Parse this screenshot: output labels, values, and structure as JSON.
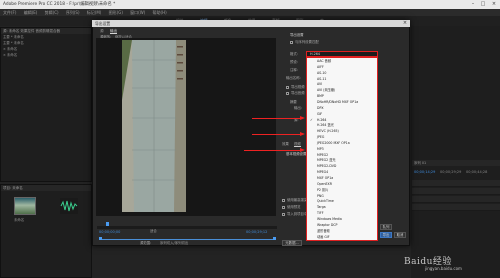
{
  "app": {
    "title": "Adobe Premiere Pro CC 2018 - F:\\pr\\编辑视频\\未命名 *",
    "menu": [
      "文件(F)",
      "编辑(E)",
      "剪辑(C)",
      "序列(S)",
      "标记(M)",
      "图形(G)",
      "窗口(W)",
      "帮助(H)"
    ],
    "workspaces": [
      "组件",
      "编辑",
      "颜色",
      "效果",
      "音频",
      "图形",
      "库"
    ],
    "active_workspace": "编辑"
  },
  "left_panel": {
    "header": "源: 未命名   效果控件   音频剪辑混合器",
    "rows": [
      "主要 * 未命名",
      "主要 * 未命名",
      "× 未命名",
      "× 未命名"
    ]
  },
  "project_panel": {
    "header": "项目: 未命名",
    "clip_label": "未命名"
  },
  "dialog": {
    "title": "导出设置",
    "close_glyph": "×",
    "tabs": [
      "源",
      "输出"
    ],
    "active_tab": "输出",
    "source_scaling_label": "源缩放:",
    "source_scaling_value": "缩放以适合",
    "timecode_start": "00;00;00;00",
    "timecode_end": "00;00;29;12",
    "fit_label": "适合",
    "source_range_label": "源范围:",
    "source_range_value": "序列切入/序列切出",
    "export_settings_header": "导出设置",
    "match_sequence_label": "与序列设置匹配",
    "format_label": "格式:",
    "format_value": "H.264",
    "preset_label": "预设:",
    "comments_label": "注释:",
    "output_name_label": "输出名称:",
    "export_video_label": "导出视频",
    "export_audio_label": "导出音频",
    "summary_label": "摘要",
    "output_label": "输出:",
    "source_label": "源:",
    "effects_tab": "效果",
    "video_tab": "视频",
    "basic_video_label": "基本视频设置",
    "max_render_label": "使用最高渲染质量",
    "use_previews_label": "使用预览",
    "import_project_label": "导入到项目中",
    "metadata_button": "元数据...",
    "queue_button": "队列",
    "export_button": "导出",
    "cancel_button": "取消"
  },
  "format_dropdown": {
    "options": [
      "AAC 音频",
      "AIFF",
      "AS-10",
      "AS-11",
      "AVI",
      "AVI (未压缩)",
      "BMP",
      "DNxHR/DNxHD MXF OP1a",
      "DPX",
      "GIF",
      "H.264",
      "H.264 蓝光",
      "HEVC (H.265)",
      "JPEG",
      "JPEG2000 MXF OP1a",
      "MP3",
      "MPEG2",
      "MPEG2 蓝光",
      "MPEG2-DVD",
      "MPEG4",
      "MXF OP1a",
      "OpenEXR",
      "P2 影片",
      "PNG",
      "QuickTime",
      "Targa",
      "TIFF",
      "Windows Media",
      "Wraptor DCP",
      "波形音频",
      "动画 GIF"
    ],
    "selected": "H.264",
    "check_glyph": "✓"
  },
  "timeline": {
    "header": "序列 01",
    "timecodes": [
      "00;00;14;29",
      "00;00;29;29",
      "00;00;44;28"
    ]
  },
  "watermark": {
    "text": "Baidu经验",
    "sub": "jingyan.baidu.com"
  },
  "colors": {
    "accent_blue": "#4a9bf0",
    "highlight_red": "#e02020",
    "panel_bg": "#1e1e1e"
  }
}
